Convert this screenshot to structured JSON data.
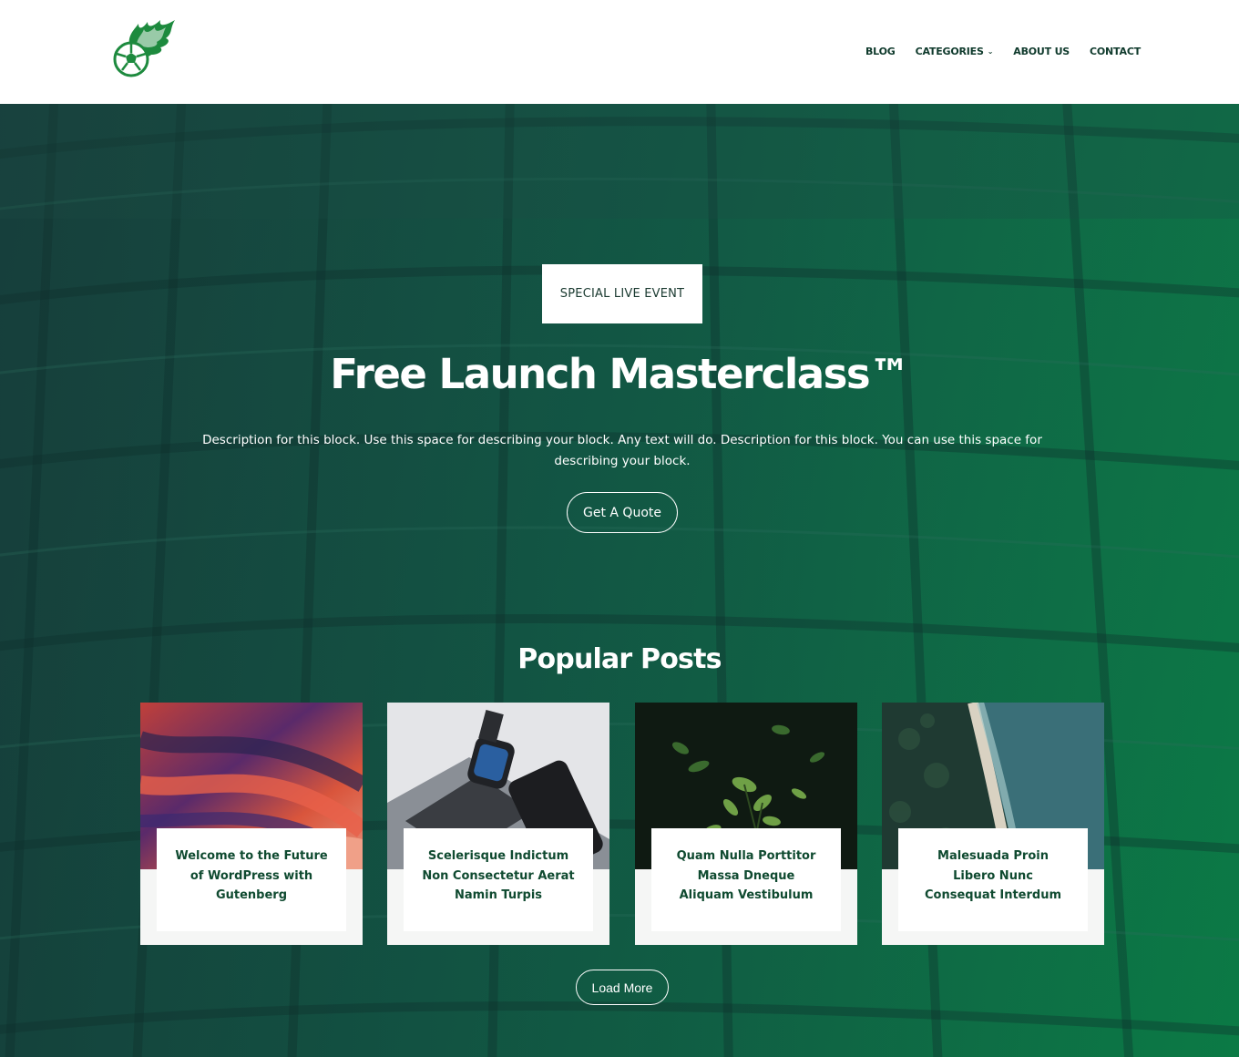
{
  "header": {
    "nav": [
      {
        "label": "BLOG"
      },
      {
        "label": "CATEGORIES"
      },
      {
        "label": "ABOUT US"
      },
      {
        "label": "CONTACT"
      }
    ]
  },
  "hero": {
    "badge": "SPECIAL LIVE EVENT",
    "title": "Free Launch Masterclass™",
    "description": "Description for this block. Use this space for describing your block. Any text will do. Description for this block. You can use this space for describing your block.",
    "cta_label": "Get A Quote"
  },
  "popular": {
    "title": "Popular Posts",
    "posts": [
      {
        "title": "Welcome to the Future of WordPress with Gutenberg"
      },
      {
        "title": "Scelerisque Indictum Non Consectetur Aerat Namin Turpis"
      },
      {
        "title": "Quam Nulla Porttitor Massa Dneque Aliquam Vestibulum"
      },
      {
        "title": "Malesuada Proin Libero Nunc Consequat Interdum"
      }
    ],
    "load_more_label": "Load More"
  },
  "colors": {
    "brand_green": "#0b7a45",
    "nav_text": "#0f3a2c",
    "card_title": "#0f4a30"
  },
  "icons": {
    "logo": "flaming-soccer-ball-logo",
    "categories_dropdown": "chevron-down-icon"
  }
}
